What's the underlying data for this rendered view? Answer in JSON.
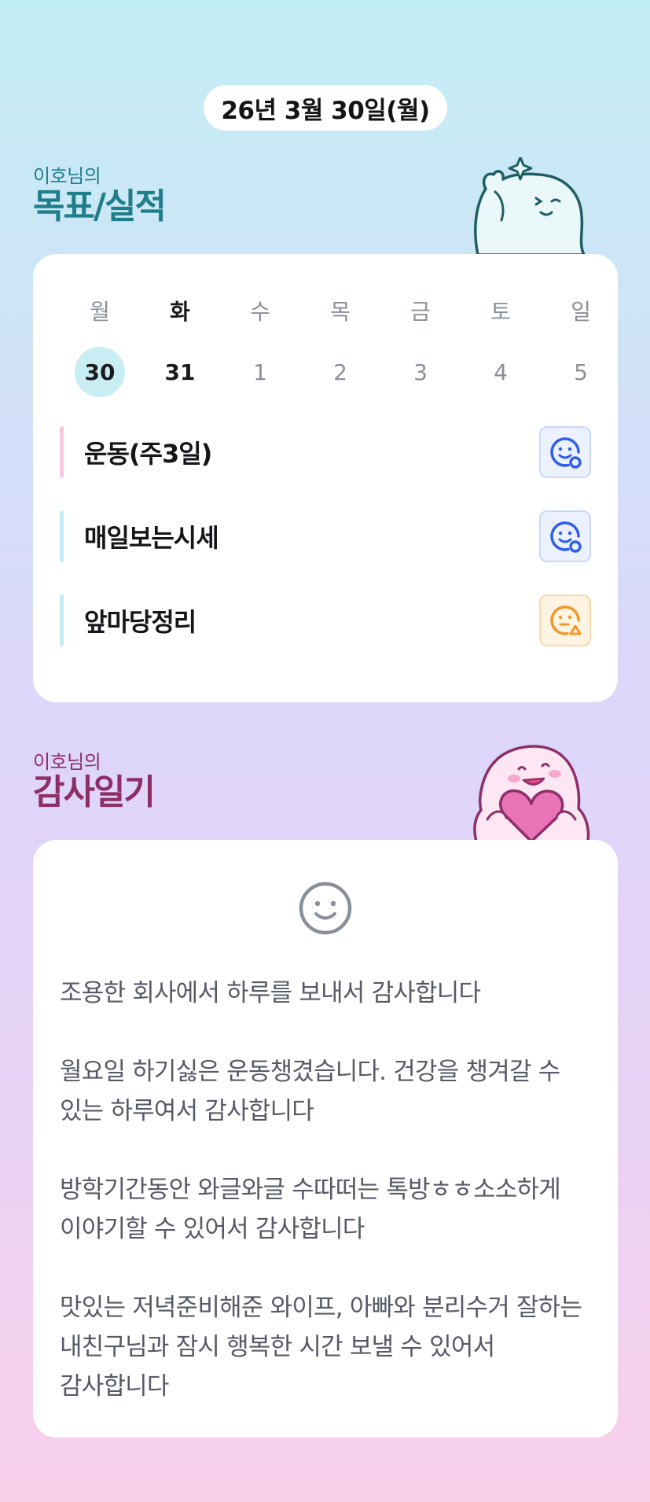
{
  "header": {
    "date": "26년 3월 30일(월)"
  },
  "goals": {
    "owner_label": "이호님의",
    "title": "목표/실적",
    "week": {
      "days": [
        "월",
        "화",
        "수",
        "목",
        "금",
        "토",
        "일"
      ],
      "dates": [
        "30",
        "31",
        "1",
        "2",
        "3",
        "4",
        "5"
      ]
    },
    "items": [
      {
        "label": "운동(주3일)",
        "bar_color": "#f9c8df",
        "status_icon": "smile-circle-icon",
        "status_color": "#2f5fe8"
      },
      {
        "label": "매일보는시세",
        "bar_color": "#c6ecf3",
        "status_icon": "smile-circle-icon",
        "status_color": "#2f5fe8"
      },
      {
        "label": "앞마당정리",
        "bar_color": "#c6ecf3",
        "status_icon": "meh-triangle-icon",
        "status_color": "#f0982b"
      }
    ]
  },
  "gratitude": {
    "owner_label": "이호님의",
    "title": "감사일기",
    "mood_icon": "smiley-face-icon",
    "entries": [
      "조용한 회사에서 하루를 보내서 감사합니다",
      "월요일 하기싫은 운동챙겼습니다. 건강을 챙겨갈 수 있는 하루여서 감사합니다",
      "방학기간동안 와글와글 수따떠는 톡방ㅎㅎ소소하게 이야기할 수 있어서 감사합니다",
      "맛있는 저녁준비해준 와이프, 아빠와 분리수거 잘하는 내친구님과 잠시 행복한 시간 보낼 수 있어서 감사합니다"
    ]
  },
  "colors": {
    "goal_title": "#1e7f8a",
    "gratitude_title": "#8e2e68",
    "selected_date_bg": "#c8eef3"
  }
}
